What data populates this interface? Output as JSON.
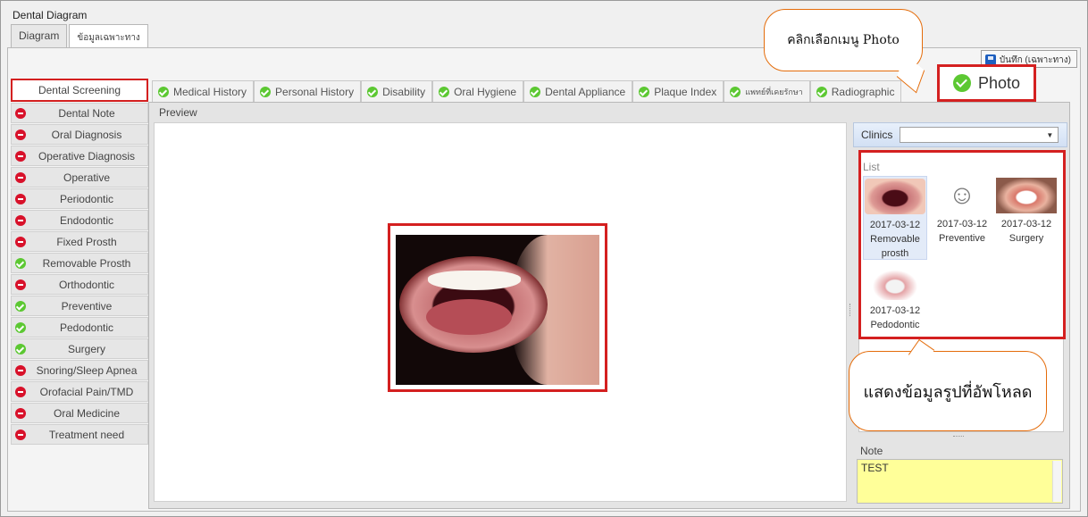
{
  "window": {
    "title": "Dental Diagram"
  },
  "top_tabs": [
    {
      "label": "Diagram",
      "active": false
    },
    {
      "label": "ข้อมูลเฉพาะทาง",
      "active": true
    }
  ],
  "toolbar": {
    "save_label": "บันทึก (เฉพาะทาง)"
  },
  "left_menu": [
    {
      "label": "Dental Screening",
      "status": "none",
      "selected": true
    },
    {
      "label": "Dental Note",
      "status": "red"
    },
    {
      "label": "Oral Diagnosis",
      "status": "red"
    },
    {
      "label": "Operative Diagnosis",
      "status": "red"
    },
    {
      "label": "Operative",
      "status": "red"
    },
    {
      "label": "Periodontic",
      "status": "red"
    },
    {
      "label": "Endodontic",
      "status": "red"
    },
    {
      "label": "Fixed Prosth",
      "status": "red"
    },
    {
      "label": "Removable Prosth",
      "status": "green"
    },
    {
      "label": "Orthodontic",
      "status": "red"
    },
    {
      "label": "Preventive",
      "status": "green"
    },
    {
      "label": "Pedodontic",
      "status": "green"
    },
    {
      "label": "Surgery",
      "status": "green"
    },
    {
      "label": "Snoring/Sleep Apnea",
      "status": "red"
    },
    {
      "label": "Orofacial Pain/TMD",
      "status": "red"
    },
    {
      "label": "Oral Medicine",
      "status": "red"
    },
    {
      "label": "Treatment need",
      "status": "red"
    }
  ],
  "sub_tabs": [
    {
      "label": "Medical History",
      "status": "green"
    },
    {
      "label": "Personal History",
      "status": "green"
    },
    {
      "label": "Disability",
      "status": "green"
    },
    {
      "label": "Oral Hygiene",
      "status": "green"
    },
    {
      "label": "Dental Appliance",
      "status": "green"
    },
    {
      "label": "Plaque Index",
      "status": "green"
    },
    {
      "label": "แพทย์ที่เคยรักษา",
      "status": "green"
    },
    {
      "label": "Radiographic",
      "status": "green"
    }
  ],
  "photo_tab": {
    "label": "Photo",
    "status": "green"
  },
  "preview": {
    "label": "Preview"
  },
  "clinics": {
    "label": "Clinics",
    "value": ""
  },
  "photo_list": {
    "label": "List",
    "items": [
      {
        "date": "2017-03-12",
        "name": "Removable prosth",
        "image": "mouth-photo",
        "selected": true
      },
      {
        "date": "2017-03-12",
        "name": "Preventive",
        "image": "tooth-cartoon",
        "selected": false
      },
      {
        "date": "2017-03-12",
        "name": "Surgery",
        "image": "smile-photo",
        "selected": false
      },
      {
        "date": "2017-03-12",
        "name": "Pedodontic",
        "image": "dental-model",
        "selected": false
      }
    ]
  },
  "note": {
    "label": "Note",
    "value": "TEST"
  },
  "callouts": {
    "photo_menu": "คลิกเลือกเมนู Photo",
    "uploaded_list": "แสดงข้อมูลรูปที่อัพโหลด"
  },
  "colors": {
    "highlight": "#d42020",
    "callout_border": "#e46c0a",
    "note_bg": "#ffff99",
    "status_red": "#d8112a",
    "status_green": "#5cc832"
  }
}
